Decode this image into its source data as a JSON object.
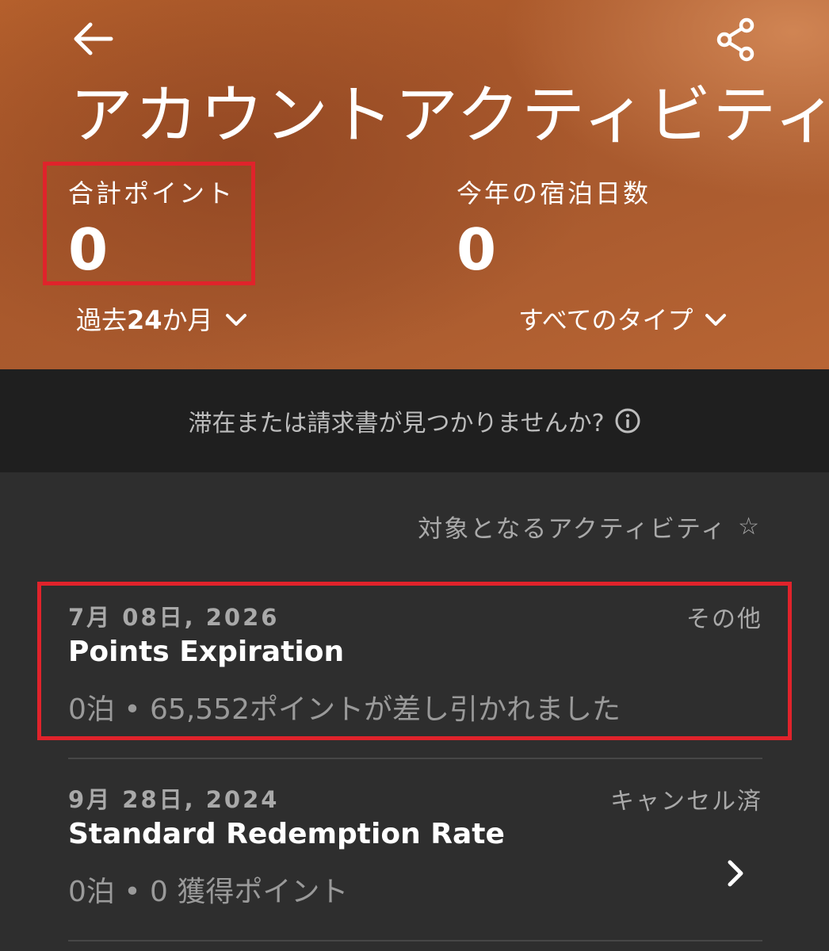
{
  "header": {
    "title": "アカウントアクティビティ",
    "back_icon": "arrow-left-icon",
    "share_icon": "share-icon"
  },
  "stats": {
    "points_label": "合計ポイント",
    "points_value": "0",
    "nights_label": "今年の宿泊日数",
    "nights_value": "0"
  },
  "filters": {
    "period_prefix": "過去 ",
    "period_bold": "24",
    "period_suffix": "か月",
    "type_label": "すべてのタイプ"
  },
  "notice": {
    "text": "滞在または請求書が見つかりませんか?",
    "icon": "info-icon"
  },
  "activity_section": {
    "label": "対象となるアクティビティ",
    "star": "☆"
  },
  "activities": [
    {
      "date": "7月 08日, 2026",
      "type": "その他",
      "title": "Points Expiration",
      "detail": "0泊 • 65,552ポイントが差し引かれました",
      "has_chevron": false
    },
    {
      "date": "9月 28日, 2024",
      "type": "キャンセル済",
      "title": "Standard Redemption Rate",
      "detail": "0泊 • 0 獲得ポイント",
      "has_chevron": true
    }
  ],
  "colors": {
    "hero_orange": "#a9582b",
    "notice_bg": "#1f1f1f",
    "list_bg": "#2e2e2e",
    "highlight_red": "#e0232b"
  }
}
